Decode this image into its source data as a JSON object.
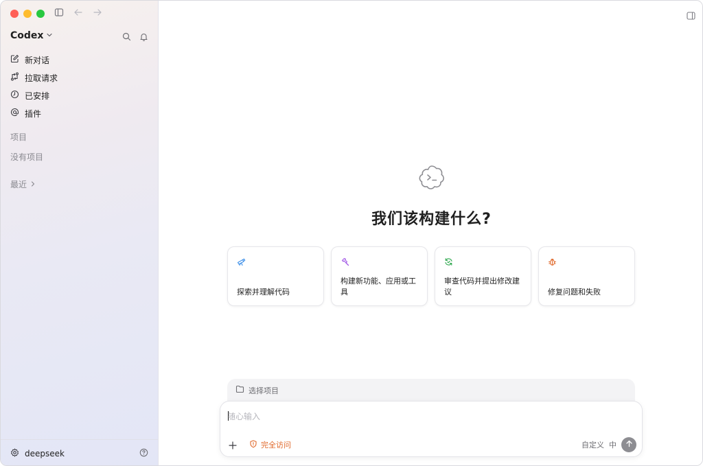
{
  "sidebar": {
    "app_title": "Codex",
    "nav": [
      {
        "label": "新对话",
        "icon": "edit-icon"
      },
      {
        "label": "拉取请求",
        "icon": "pull-request-icon"
      },
      {
        "label": "已安排",
        "icon": "clock-icon"
      },
      {
        "label": "插件",
        "icon": "at-icon"
      }
    ],
    "projects_label": "项目",
    "no_projects_label": "没有项目",
    "recent_label": "最近",
    "footer_user": "deepseek"
  },
  "main": {
    "hero_title": "我们该构建什么?",
    "cards": [
      {
        "label": "探索并理解代码",
        "icon": "telescope-icon",
        "color": "#3b8ee8"
      },
      {
        "label": "构建新功能、应用或工具",
        "icon": "hammer-icon",
        "color": "#a259e6"
      },
      {
        "label": "审查代码并提出修改建议",
        "icon": "refresh-check-icon",
        "color": "#2fa84f"
      },
      {
        "label": "修复问题和失败",
        "icon": "bug-icon",
        "color": "#e0682a"
      }
    ],
    "project_select_label": "选择项目",
    "composer": {
      "placeholder": "随心输入",
      "access_label": "完全访问",
      "custom_label": "自定义",
      "lang_label": "中"
    }
  },
  "colors": {
    "accent_orange": "#e0682a",
    "send_button": "#8d8d92"
  }
}
